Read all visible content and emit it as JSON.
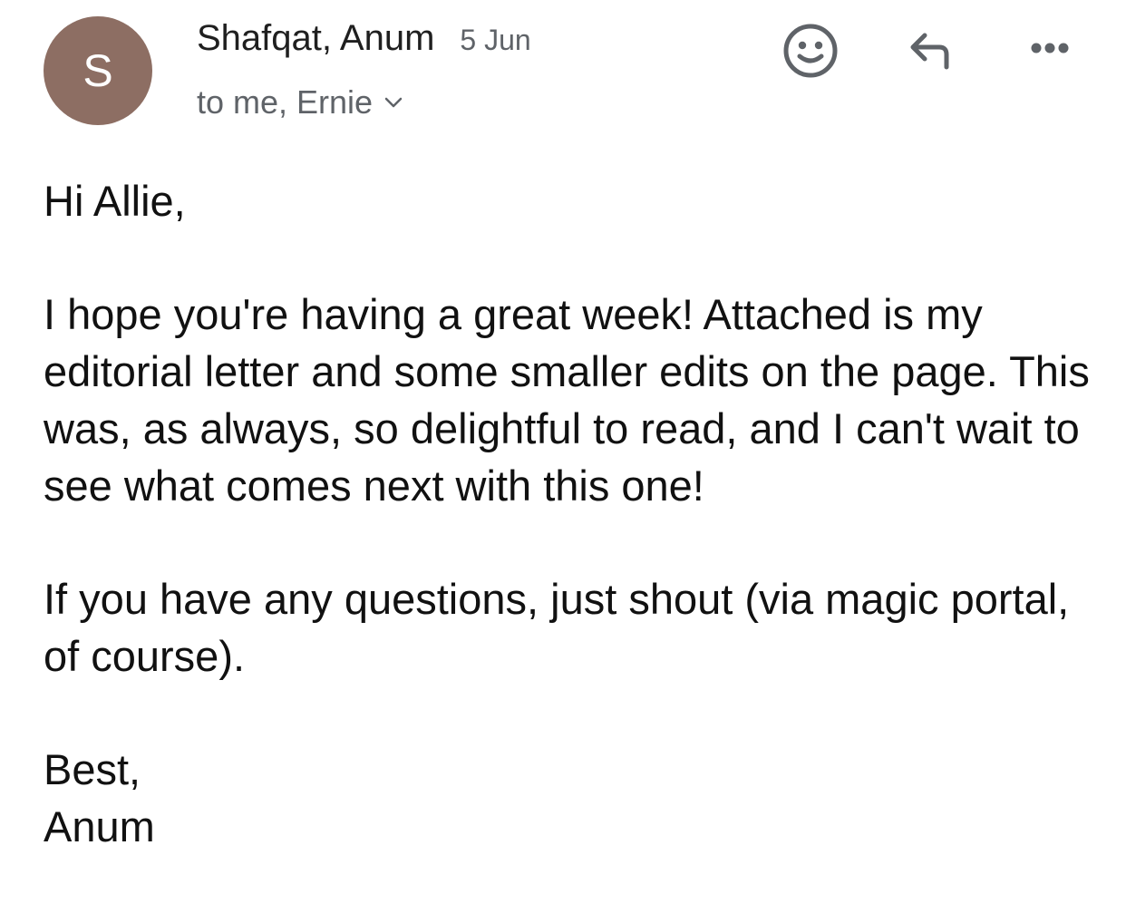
{
  "colors": {
    "avatar_bg": "#8d6e63",
    "icon_gray": "#5f6368",
    "text_dark": "#111111"
  },
  "email": {
    "avatar_initial": "S",
    "sender": "Shafqat, Anum",
    "date": "5 Jun",
    "recipients": "to me, Ernie",
    "icons": {
      "emoji": "smiley-icon",
      "reply": "reply-arrow-icon",
      "more": "more-dots-icon",
      "chevron": "chevron-down-icon"
    },
    "greeting": "Hi Allie,",
    "paragraph_1": "I hope you're having a great week! Attached is my editorial letter and some smaller edits on the page. This was, as always, so delightful to read, and I can't wait to see what comes next with this one!",
    "paragraph_2": "If you have any questions, just shout (via magic portal, of course).",
    "signoff": "Best,",
    "signature": "Anum"
  }
}
